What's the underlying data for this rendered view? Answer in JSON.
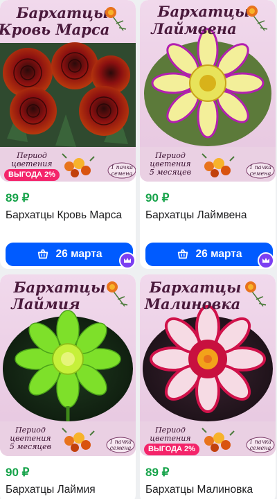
{
  "colors": {
    "price": "#16a34a",
    "button": "#005bff",
    "promo": "#f4246a",
    "badge": "#7b3ff2"
  },
  "products": [
    {
      "image_title_line1": "Бархатцы",
      "image_title_line2": "Кровь Марса",
      "period_line1": "Период",
      "period_line2": "цветения",
      "period_line3": "",
      "pack_line1": "1 пачка",
      "pack_line2": "семена",
      "promo": "ВЫГОДА 2%",
      "price": "89 ₽",
      "title": "Бархатцы Кровь Марса",
      "delivery": "26 марта",
      "basket_icon": "basket-icon",
      "badge_icon": "crown-icon"
    },
    {
      "image_title_line1": "Бархатцы",
      "image_title_line2": "Лаймвена",
      "period_line1": "Период",
      "period_line2": "цветения",
      "period_line3": "5 месяцев",
      "pack_line1": "1 пачка",
      "pack_line2": "семена",
      "promo": "",
      "price": "90 ₽",
      "title": "Бархатцы Лаймвена",
      "delivery": "26 марта",
      "basket_icon": "basket-icon",
      "badge_icon": "crown-icon"
    },
    {
      "image_title_line1": "Бархатцы",
      "image_title_line2": "Лаймия",
      "period_line1": "Период",
      "period_line2": "цветения",
      "period_line3": "5 месяцев",
      "pack_line1": "1 пачка",
      "pack_line2": "семена",
      "promo": "",
      "price": "90 ₽",
      "title": "Бархатцы Лаймия"
    },
    {
      "image_title_line1": "Бархатцы",
      "image_title_line2": "Малиновка",
      "period_line1": "Период",
      "period_line2": "цветения",
      "period_line3": "",
      "pack_line1": "1 пачка",
      "pack_line2": "семена",
      "promo": "ВЫГОДА 2%",
      "price": "89 ₽",
      "title": "Бархатцы Малиновка"
    }
  ]
}
